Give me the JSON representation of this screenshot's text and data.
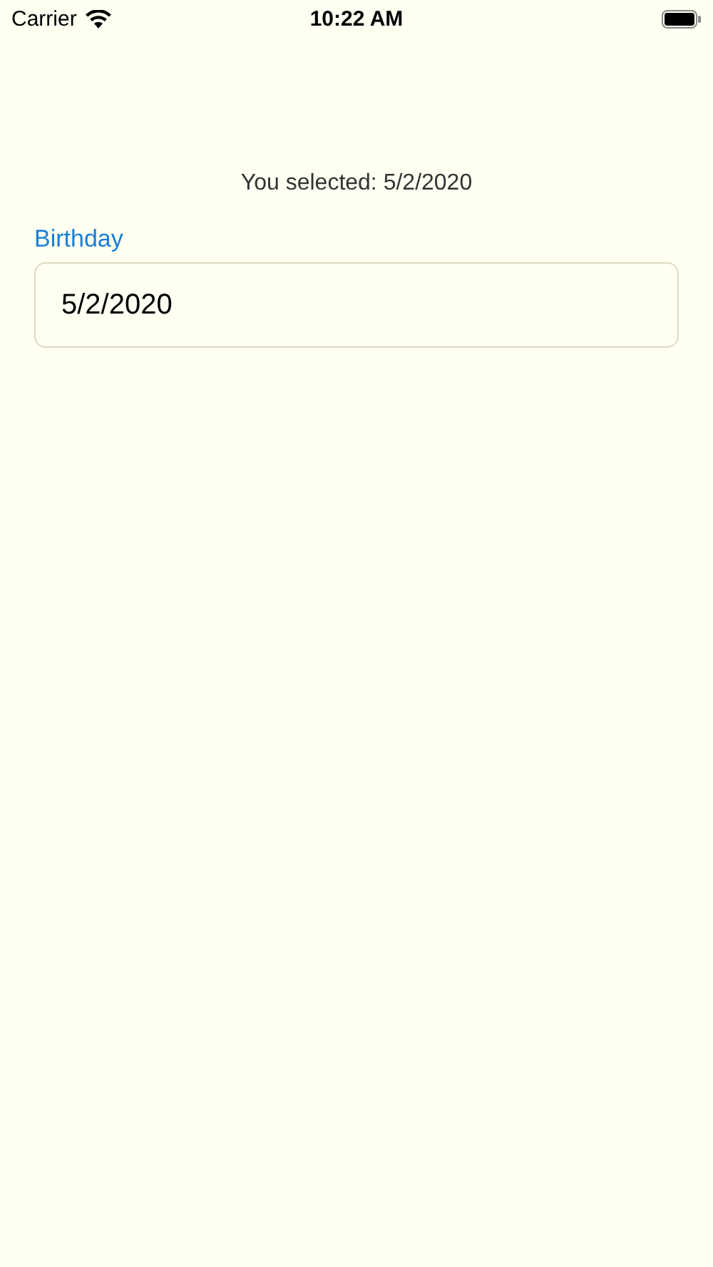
{
  "status_bar": {
    "carrier": "Carrier",
    "time": "10:22 AM"
  },
  "selection_text": "You selected: 5/2/2020",
  "field": {
    "label": "Birthday",
    "value": "5/2/2020"
  }
}
